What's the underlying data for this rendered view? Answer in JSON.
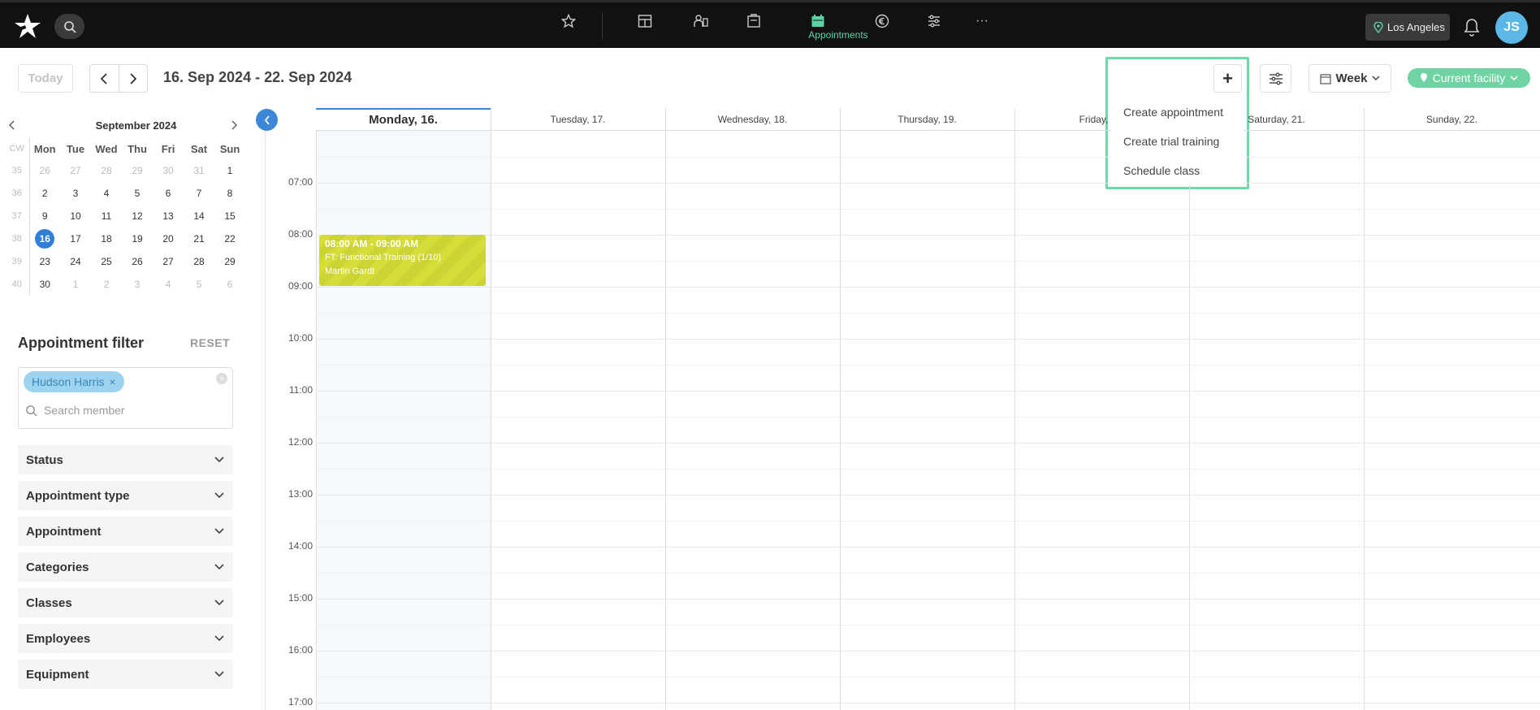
{
  "topbar": {
    "location": "Los Angeles",
    "avatar_initials": "JS",
    "active_nav_label": "Appointments",
    "nav_icons": [
      "star-icon",
      "dashboard-icon",
      "members-icon",
      "checkin-icon",
      "appointments-icon",
      "finance-icon",
      "settings-sliders-icon",
      "more-icon"
    ]
  },
  "toolbar": {
    "today_label": "Today",
    "date_range": "16. Sep 2024 - 22. Sep 2024",
    "plus_label": "+",
    "view_label": "Week",
    "facility_label": "Current facility"
  },
  "dropdown": {
    "items": [
      "Create appointment",
      "Create trial training",
      "Schedule class"
    ]
  },
  "mini_calendar": {
    "title": "September 2024",
    "cw_header": "CW",
    "weekdays": [
      "Mon",
      "Tue",
      "Wed",
      "Thu",
      "Fri",
      "Sat",
      "Sun"
    ],
    "weeks": [
      {
        "cw": "35",
        "days": [
          "26",
          "27",
          "28",
          "29",
          "30",
          "31",
          "1"
        ],
        "muted": [
          0,
          1,
          2,
          3,
          4,
          5
        ]
      },
      {
        "cw": "36",
        "days": [
          "2",
          "3",
          "4",
          "5",
          "6",
          "7",
          "8"
        ],
        "muted": []
      },
      {
        "cw": "37",
        "days": [
          "9",
          "10",
          "11",
          "12",
          "13",
          "14",
          "15"
        ],
        "muted": []
      },
      {
        "cw": "38",
        "days": [
          "16",
          "17",
          "18",
          "19",
          "20",
          "21",
          "22"
        ],
        "muted": [],
        "selected": 0
      },
      {
        "cw": "39",
        "days": [
          "23",
          "24",
          "25",
          "26",
          "27",
          "28",
          "29"
        ],
        "muted": []
      },
      {
        "cw": "40",
        "days": [
          "30",
          "1",
          "2",
          "3",
          "4",
          "5",
          "6"
        ],
        "muted": [
          1,
          2,
          3,
          4,
          5,
          6
        ]
      }
    ]
  },
  "filter": {
    "title": "Appointment filter",
    "reset_label": "RESET",
    "selected_member": "Hudson Harris",
    "search_placeholder": "Search member",
    "sections": [
      "Status",
      "Appointment type",
      "Appointment",
      "Categories",
      "Classes",
      "Employees",
      "Equipment"
    ]
  },
  "calendar": {
    "days": [
      "Monday, 16.",
      "Tuesday, 17.",
      "Wednesday, 18.",
      "Thursday, 19.",
      "Friday, 20.",
      "Saturday, 21.",
      "Sunday, 22."
    ],
    "times": [
      "07:00",
      "08:00",
      "09:00",
      "10:00",
      "11:00",
      "12:00",
      "13:00",
      "14:00",
      "15:00",
      "16:00",
      "17:00"
    ],
    "event": {
      "time": "08:00 AM - 09:00 AM",
      "title": "FT: Functional Training (1/10)",
      "person": "Martin Gardt"
    }
  },
  "colors": {
    "accent_green": "#6fd3a3",
    "highlight_border": "#6ed9ab",
    "selected_blue": "#2f7ed8",
    "event_yellow": "#d6dd3a"
  }
}
